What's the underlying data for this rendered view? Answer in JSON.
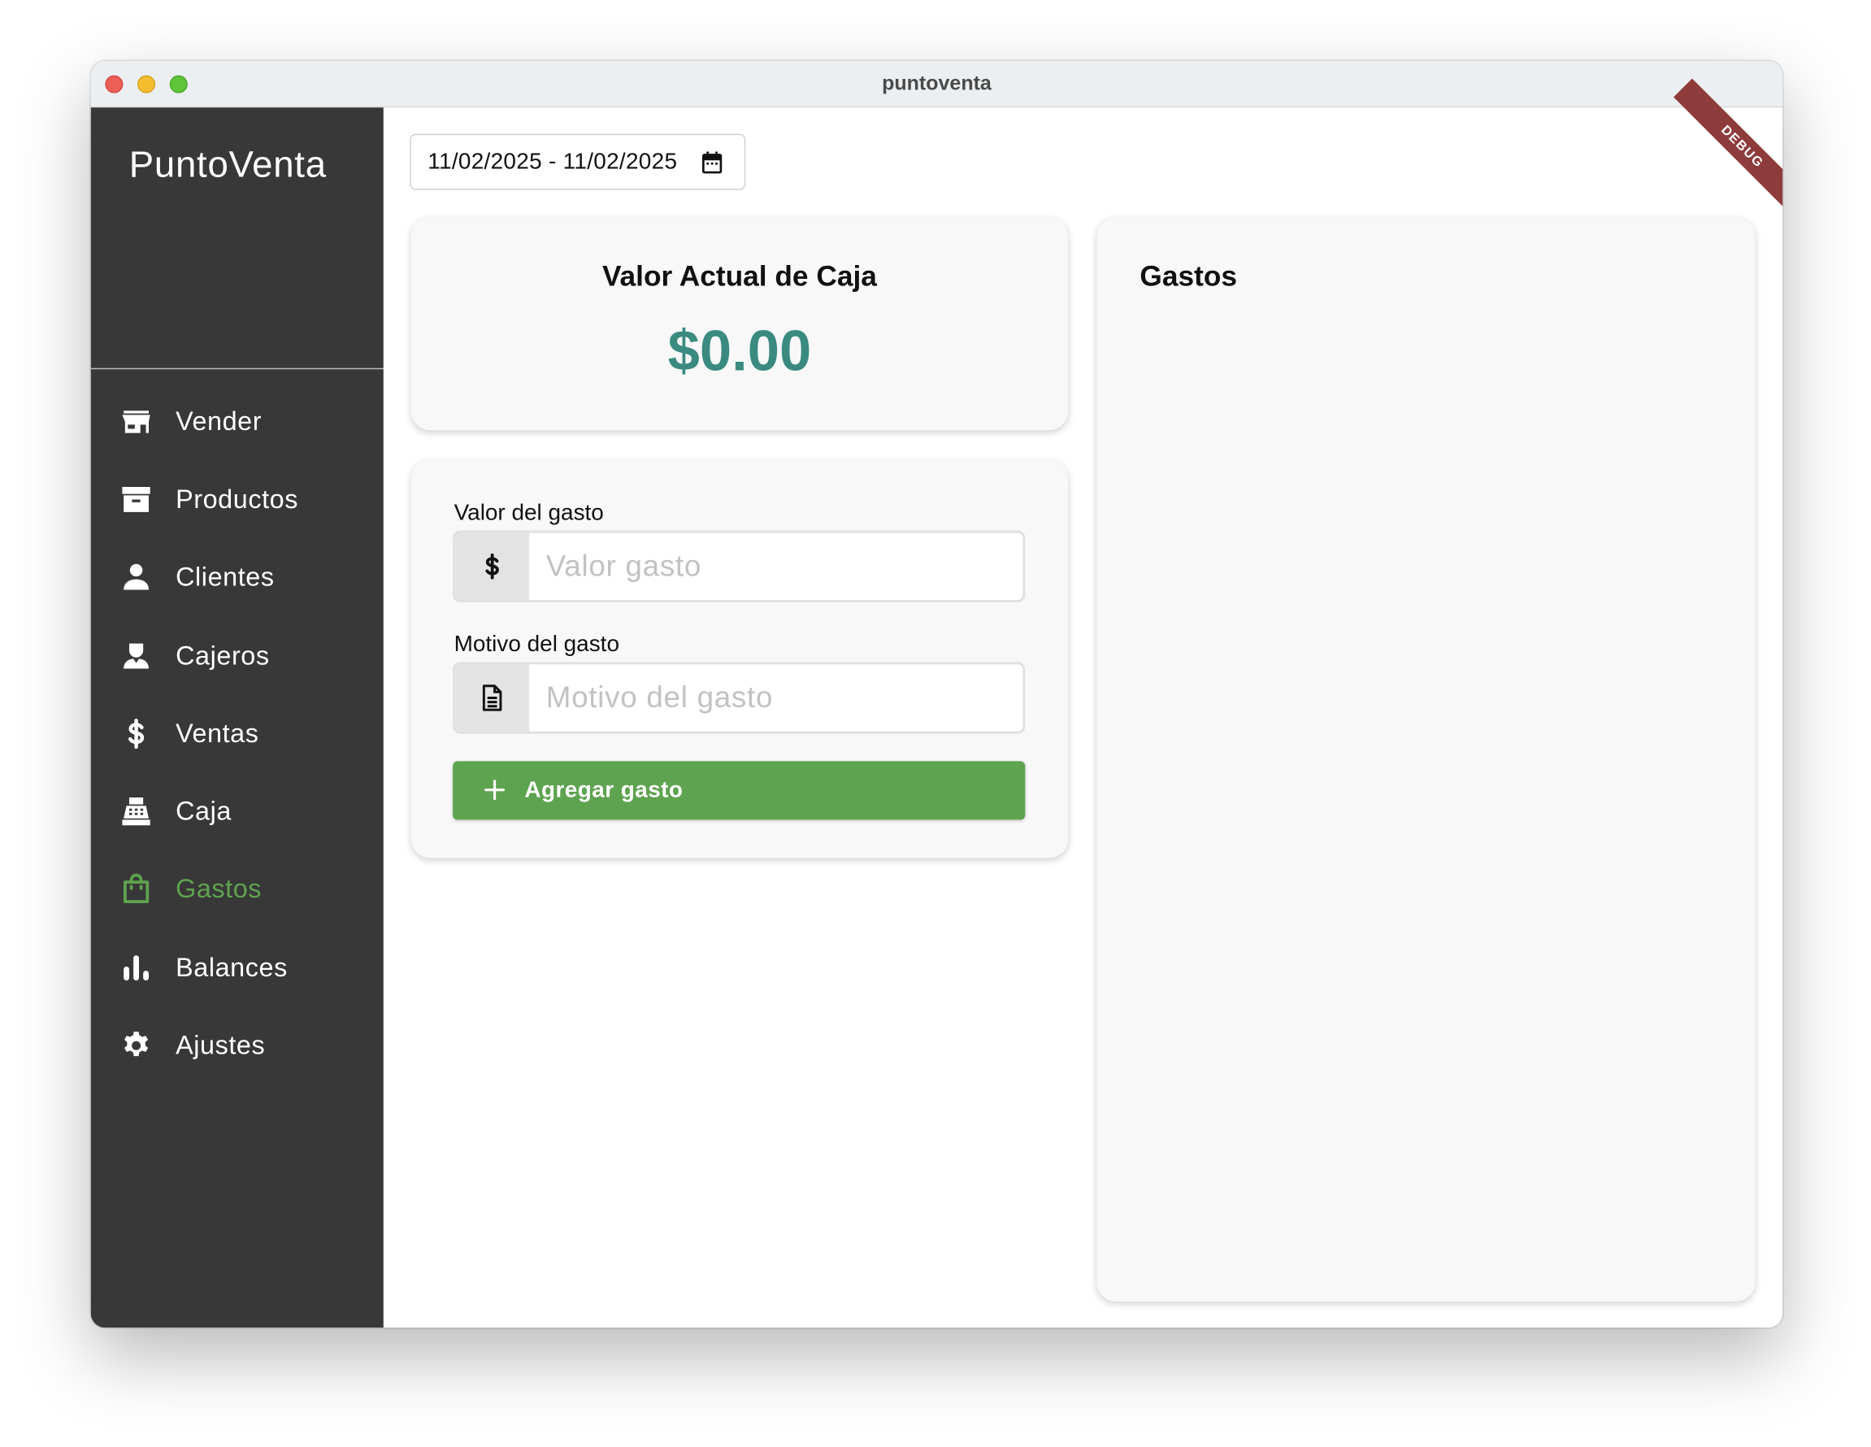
{
  "window": {
    "title": "puntoventa"
  },
  "sidebar": {
    "brand": "PuntoVenta",
    "items": [
      {
        "label": "Vender",
        "icon": "store-icon",
        "active": false
      },
      {
        "label": "Productos",
        "icon": "archive-box-icon",
        "active": false
      },
      {
        "label": "Clientes",
        "icon": "person-icon",
        "active": false
      },
      {
        "label": "Cajeros",
        "icon": "cashier-person-icon",
        "active": false
      },
      {
        "label": "Ventas",
        "icon": "dollar-icon",
        "active": false
      },
      {
        "label": "Caja",
        "icon": "cash-register-icon",
        "active": false
      },
      {
        "label": "Gastos",
        "icon": "shopping-bag-icon",
        "active": true
      },
      {
        "label": "Balances",
        "icon": "bar-chart-icon",
        "active": false
      },
      {
        "label": "Ajustes",
        "icon": "gear-icon",
        "active": false
      }
    ]
  },
  "filters": {
    "date_range": "11/02/2025 - 11/02/2025"
  },
  "debug_banner": "DEBUG",
  "caja": {
    "title": "Valor Actual de Caja",
    "value": "$0.00"
  },
  "form": {
    "amount_label": "Valor del gasto",
    "amount_placeholder": "Valor gasto",
    "reason_label": "Motivo del gasto",
    "reason_placeholder": "Motivo del gasto",
    "submit_label": "Agregar gasto"
  },
  "gastos": {
    "title": "Gastos"
  },
  "colors": {
    "accent": "#5ea34f",
    "caja_value": "#3a8a80",
    "sidebar_bg": "#383838",
    "debug": "#8e3b3b"
  }
}
